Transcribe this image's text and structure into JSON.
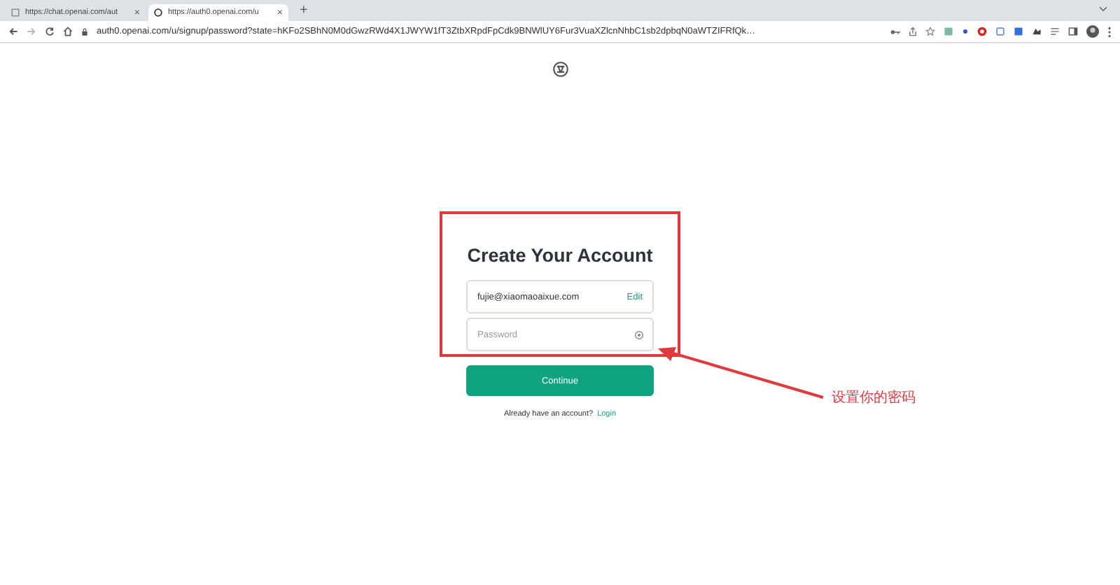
{
  "browser": {
    "tabs": [
      {
        "title": "https://chat.openai.com/aut",
        "selected": false,
        "close": "×"
      },
      {
        "title": "https://auth0.openai.com/u",
        "selected": true,
        "close": "×"
      }
    ],
    "new_tab": "+",
    "url": "auth0.openai.com/u/signup/password?state=hKFo2SBhN0M0dGwzRWd4X1JWYW1fT3ZtbXRpdFpCdk9BNWlUY6Fur3VuaXZlcnNhbC1sb2dpbqN0aWTZIFRfQk…"
  },
  "form": {
    "title": "Create Your Account",
    "email": "fujie@xiaomaoaixue.com",
    "edit_link": "Edit",
    "password_placeholder": "Password",
    "button": "Continue",
    "login_prompt": "Already have an account?",
    "login_link": "Login"
  },
  "annotation": {
    "text": "设置你的密码"
  }
}
